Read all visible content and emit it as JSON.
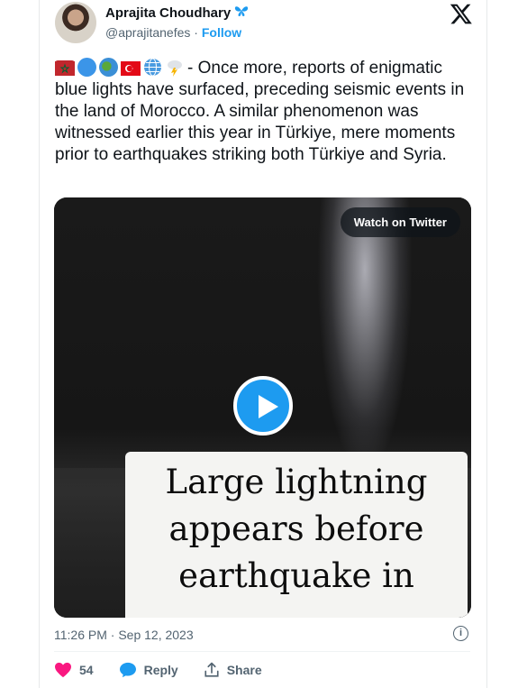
{
  "author": {
    "name": "Aprajita Choudhary",
    "badge_icon": "butterfly-icon",
    "handle": "@aprajitanefes",
    "separator": "·",
    "follow_label": "Follow"
  },
  "tweet": {
    "emoji_icons": [
      "morocco-flag-icon",
      "blue-circle-icon",
      "earth-africa-icon",
      "turkey-flag-icon",
      "globe-icon",
      "cloud-lightning-icon"
    ],
    "text": "- Once more, reports of enigmatic blue lights have surfaced, preceding seismic events in the land of Morocco. A similar phenomenon was witnessed earlier this year in Türkiye, mere moments prior to earthquakes striking both Türkiye and Syria."
  },
  "media": {
    "watch_label": "Watch on Twitter",
    "caption_lines": [
      "Large lightning",
      "appears before",
      "earthquake in"
    ]
  },
  "meta": {
    "timestamp": "11:26 PM · Sep 12, 2023"
  },
  "actions": {
    "like_count": "54",
    "reply_label": "Reply",
    "share_label": "Share"
  },
  "colors": {
    "accent": "#1d9bf0",
    "like": "#f91880",
    "muted": "#536471"
  }
}
